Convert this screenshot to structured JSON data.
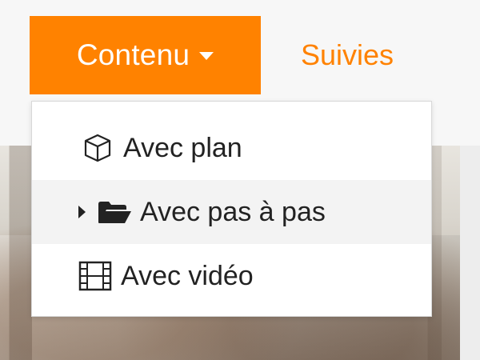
{
  "nav": {
    "content_button": "Contenu",
    "followed_link": "Suivies",
    "accent_color": "#ff8200"
  },
  "menu": {
    "items": [
      {
        "label": "Avec plan",
        "icon": "cube-icon"
      },
      {
        "label": "Avec pas à pas",
        "icon": "folder-open-icon",
        "submenu": true,
        "highlighted": true
      },
      {
        "label": "Avec vidéo",
        "icon": "film-icon"
      }
    ]
  }
}
